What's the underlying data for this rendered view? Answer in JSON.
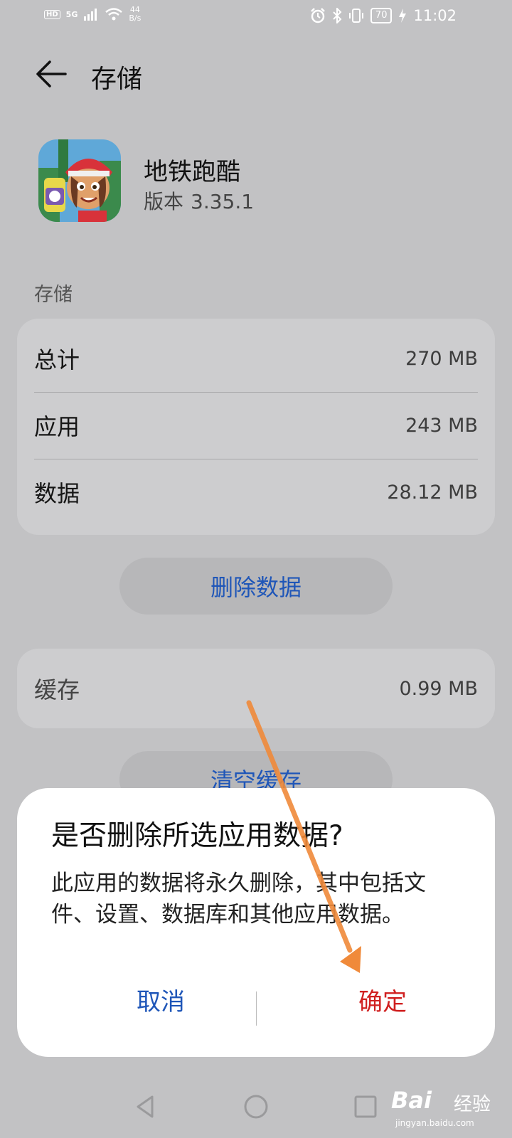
{
  "status_bar": {
    "hd": "HD",
    "network": "5G",
    "net_speed_value": "44",
    "net_speed_unit": "B/s",
    "battery": "70",
    "time": "11:02"
  },
  "header": {
    "title": "存储"
  },
  "app": {
    "name": "地铁跑酷",
    "version_label": "版本",
    "version": "3.35.1"
  },
  "storage": {
    "section_title": "存储",
    "rows": [
      {
        "label": "总计",
        "value": "270 MB"
      },
      {
        "label": "应用",
        "value": "243 MB"
      },
      {
        "label": "数据",
        "value": "28.12 MB"
      }
    ],
    "delete_data_label": "删除数据"
  },
  "cache": {
    "label": "缓存",
    "value": "0.99 MB",
    "clear_label": "清空缓存"
  },
  "dialog": {
    "title": "是否删除所选应用数据?",
    "body": "此应用的数据将永久删除，其中包括文件、设置、数据库和其他应用数据。",
    "cancel_label": "取消",
    "confirm_label": "确定"
  },
  "watermark": {
    "logo": "Bai",
    "text": "经验",
    "site": "jingyan.baidu.com"
  },
  "colors": {
    "accent_blue": "#1f56b8",
    "confirm_red": "#d02020",
    "annotation_arrow": "#f08a3a"
  }
}
